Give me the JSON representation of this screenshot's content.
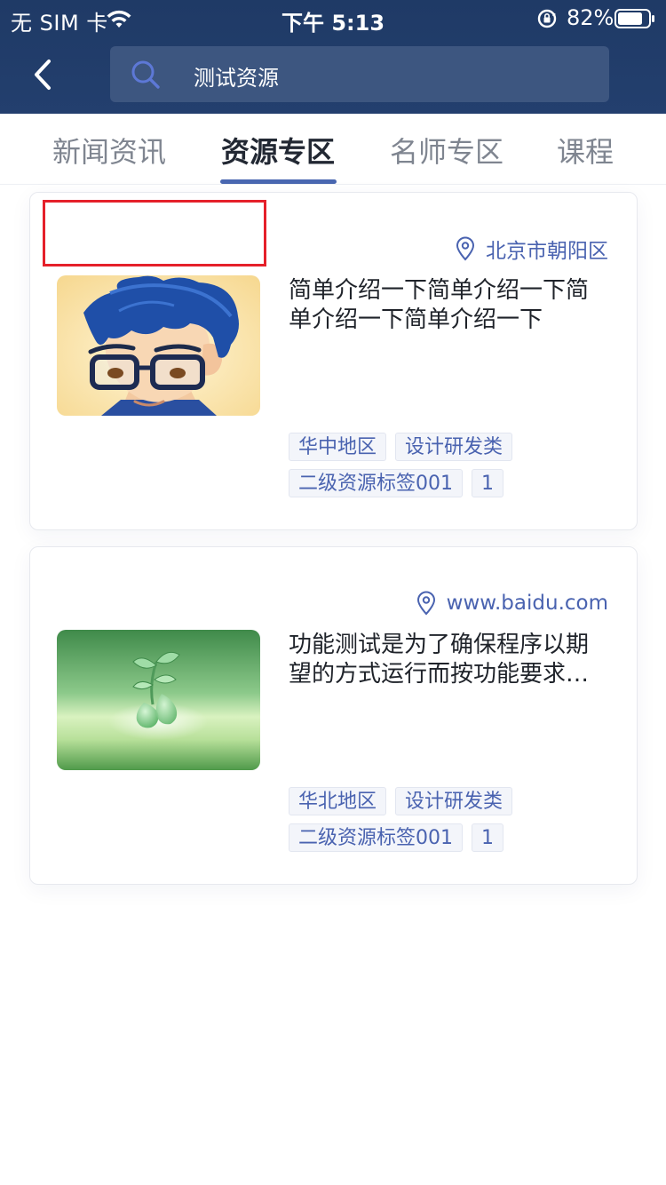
{
  "status_bar": {
    "carrier": "无 SIM 卡",
    "time": "下午 5:13",
    "battery": "82%"
  },
  "header": {
    "back_icon": "chevron-left-icon",
    "search_icon": "search-icon",
    "search_text": "测试资源"
  },
  "tabs": [
    {
      "label": "新闻资讯",
      "active": false
    },
    {
      "label": "资源专区",
      "active": true
    },
    {
      "label": "名师专区",
      "active": false
    },
    {
      "label": "课程",
      "active": false
    }
  ],
  "cards": [
    {
      "location": "北京市朝阳区",
      "description": "简单介绍一下简单介绍一下简单介绍一下简单介绍一下",
      "tags": [
        "华中地区",
        "设计研发类",
        "二级资源标签001",
        "1"
      ]
    },
    {
      "location": "www.baidu.com",
      "description": "功能测试是为了确保程序以期望的方式运行而按功能要求进行的测试",
      "tags": [
        "华北地区",
        "设计研发类",
        "二级资源标签001",
        "1"
      ]
    }
  ],
  "colors": {
    "header_bg": "#1f3a66",
    "accent": "#4866b0",
    "highlight": "#e5202a"
  }
}
